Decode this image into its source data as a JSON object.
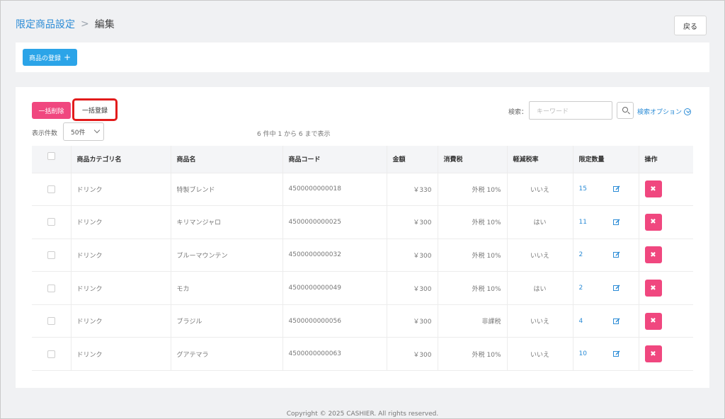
{
  "breadcrumb": {
    "parent": "限定商品設定",
    "current": "編集"
  },
  "back_label": "戻る",
  "register_button": "商品の登録",
  "register_plus": "+",
  "toolbar": {
    "bulk_delete": "一括削除",
    "bulk_register": "一括登録",
    "perpage_label": "表示件数",
    "perpage_value": "50件",
    "count_text": "6 件中 1 から 6 まで表示",
    "search_label": "検索：",
    "search_placeholder": "キーワード",
    "search_option": "検索オプション"
  },
  "table": {
    "headers": [
      "商品カテゴリ名",
      "商品名",
      "商品コード",
      "金額",
      "消費税",
      "軽減税率",
      "限定数量",
      "操作"
    ],
    "rows": [
      {
        "category": "ドリンク",
        "name": "特製ブレンド",
        "code": "4500000000018",
        "price": "￥330",
        "tax": "外税 10%",
        "reduced": "いいえ",
        "limit": "15"
      },
      {
        "category": "ドリンク",
        "name": "キリマンジャロ",
        "code": "4500000000025",
        "price": "￥300",
        "tax": "外税 10%",
        "reduced": "はい",
        "limit": "11"
      },
      {
        "category": "ドリンク",
        "name": "ブルーマウンテン",
        "code": "4500000000032",
        "price": "￥300",
        "tax": "外税 10%",
        "reduced": "いいえ",
        "limit": "2"
      },
      {
        "category": "ドリンク",
        "name": "モカ",
        "code": "4500000000049",
        "price": "￥300",
        "tax": "外税 10%",
        "reduced": "はい",
        "limit": "2"
      },
      {
        "category": "ドリンク",
        "name": "ブラジル",
        "code": "4500000000056",
        "price": "￥300",
        "tax": "非課税",
        "reduced": "いいえ",
        "limit": "4"
      },
      {
        "category": "ドリンク",
        "name": "グアテマラ",
        "code": "4500000000063",
        "price": "￥300",
        "tax": "外税 10%",
        "reduced": "いいえ",
        "limit": "10"
      }
    ]
  },
  "footer": "Copyright © 2025 CASHIER. All rights reserved.",
  "colors": {
    "accent": "#2ba4e8",
    "danger": "#f0477f",
    "highlight": "#e21b1b"
  }
}
